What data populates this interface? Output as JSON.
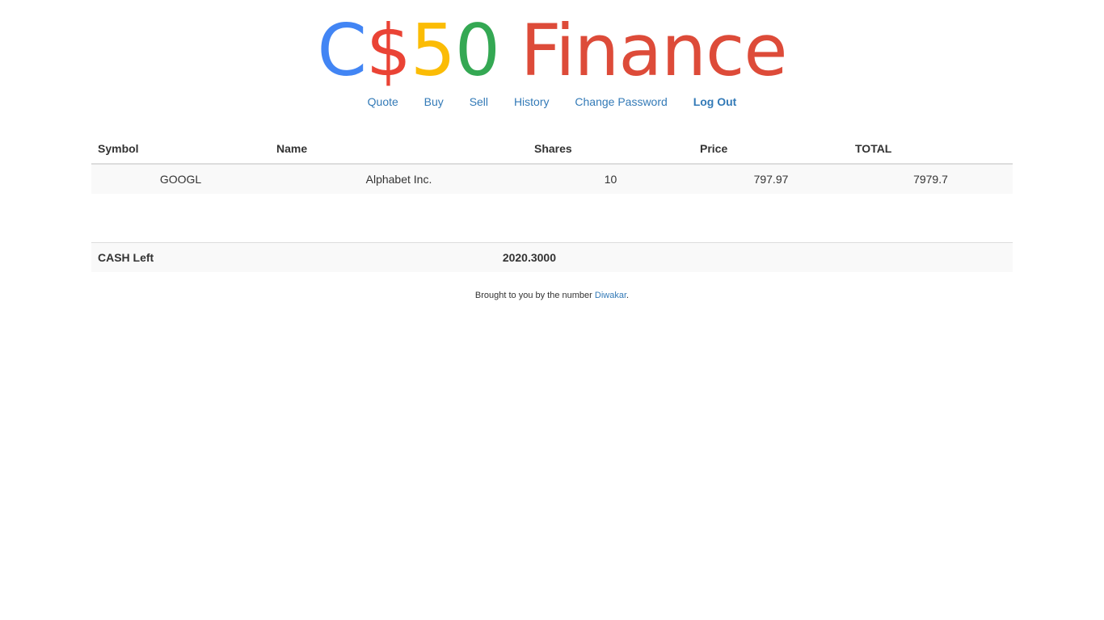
{
  "logo": {
    "letters": [
      {
        "text": "C",
        "color": "#4285f4"
      },
      {
        "text": "$",
        "color": "#ea4335"
      },
      {
        "text": "5",
        "color": "#fbbc05"
      },
      {
        "text": "0",
        "color": "#34a853"
      }
    ],
    "word": "Finance",
    "word_color": "#dd4b39"
  },
  "nav": {
    "items": [
      {
        "label": "Quote"
      },
      {
        "label": "Buy"
      },
      {
        "label": "Sell"
      },
      {
        "label": "History"
      },
      {
        "label": "Change Password"
      },
      {
        "label": "Log Out"
      }
    ]
  },
  "table": {
    "headers": [
      "Symbol",
      "Name",
      "Shares",
      "Price",
      "TOTAL"
    ],
    "rows": [
      {
        "symbol": "GOOGL",
        "name": "Alphabet Inc.",
        "shares": "10",
        "price": "797.97",
        "total": "7979.7"
      }
    ],
    "cash": {
      "label": "CASH Left",
      "value": "2020.3000"
    }
  },
  "footer": {
    "text": "Brought to you by the number ",
    "link": "Diwakar",
    "suffix": "."
  },
  "colors": {
    "link": "#337ab7",
    "stripe": "#f9f9f9"
  }
}
